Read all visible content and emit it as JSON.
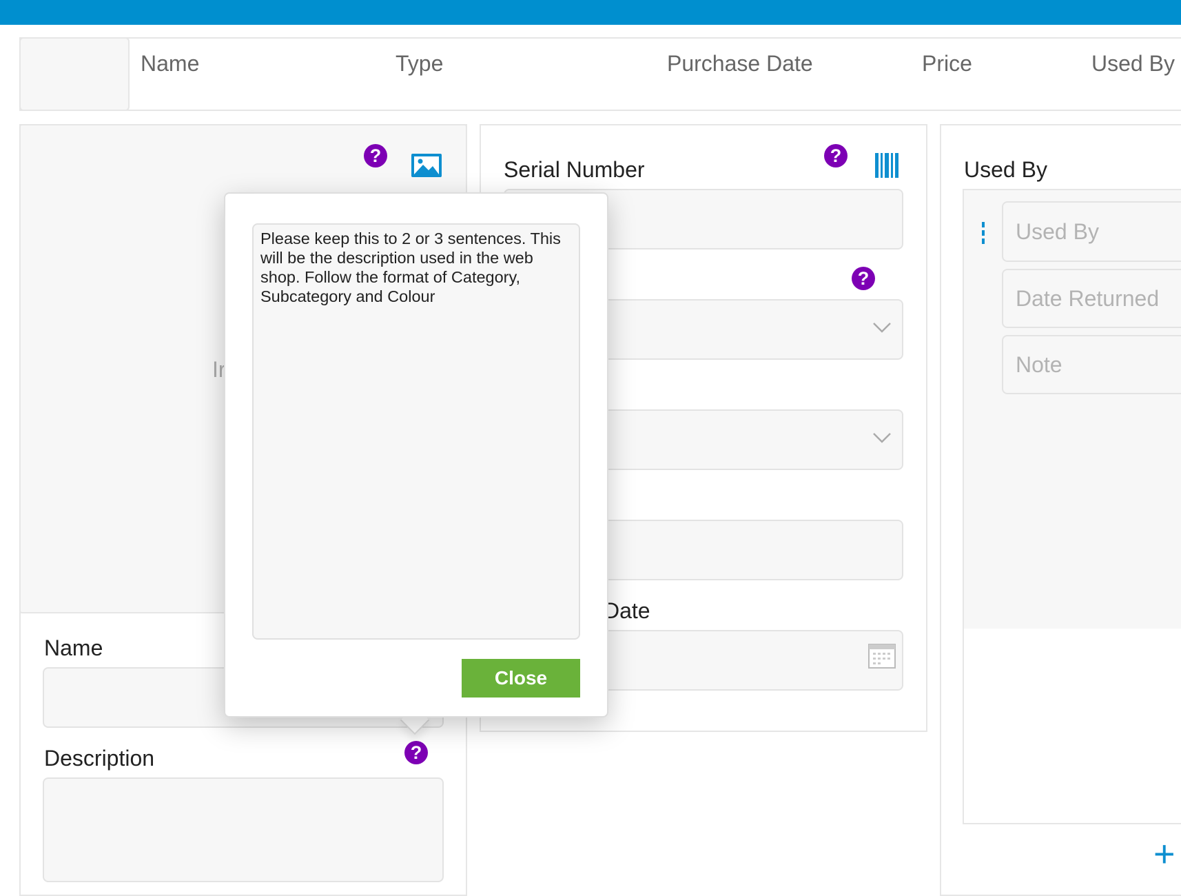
{
  "header": {
    "columns": [
      "Name",
      "Type",
      "Purchase Date",
      "Price",
      "Used By"
    ]
  },
  "left_panel": {
    "image_placeholder_fragment": "Ir",
    "name_label": "Name",
    "description_label": "Description"
  },
  "middle_panel": {
    "serial_label": "Serial Number",
    "date_label_fragment": "Date"
  },
  "right_panel": {
    "title": "Used By",
    "used_by_placeholder": "Used By",
    "date_returned_placeholder": "Date Returned",
    "note_placeholder": "Note",
    "add_symbol": "+"
  },
  "popup": {
    "text": "Please keep this to 2 or 3 sentences. This will be the description used in the web shop. Follow the format of Category, Subcategory and Colour",
    "close_label": "Close"
  },
  "icons": {
    "help": "?",
    "help_color": "#7d00b4",
    "accent_color": "#008fcf",
    "close_color": "#6ab23a"
  }
}
